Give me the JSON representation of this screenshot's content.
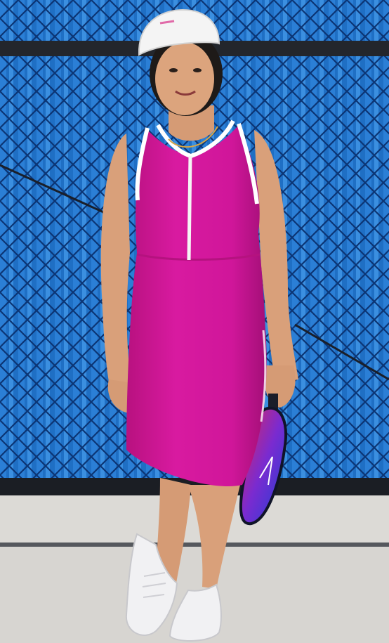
{
  "scene": {
    "subject": "woman-in-tennis-dress",
    "colors": {
      "fence_blue": "#1f6fc4",
      "fence_dark": "#0f3f86",
      "fence_light": "#4a97e0",
      "rail": "#2a2e35",
      "ground": "#dcdad6",
      "ground_shadow": "#c9c7c3",
      "dress": "#d0169a",
      "dress_shade": "#a8107c",
      "trim": "#ffffff",
      "skin": "#d9a07a",
      "skin_shade": "#b98462",
      "hair": "#1e1a18",
      "cap": "#f4f4f4",
      "shoe": "#f1f1f3",
      "paddle_blue": "#1e3fd6",
      "paddle_red": "#e0285a",
      "paddle_edge": "#101428"
    }
  }
}
